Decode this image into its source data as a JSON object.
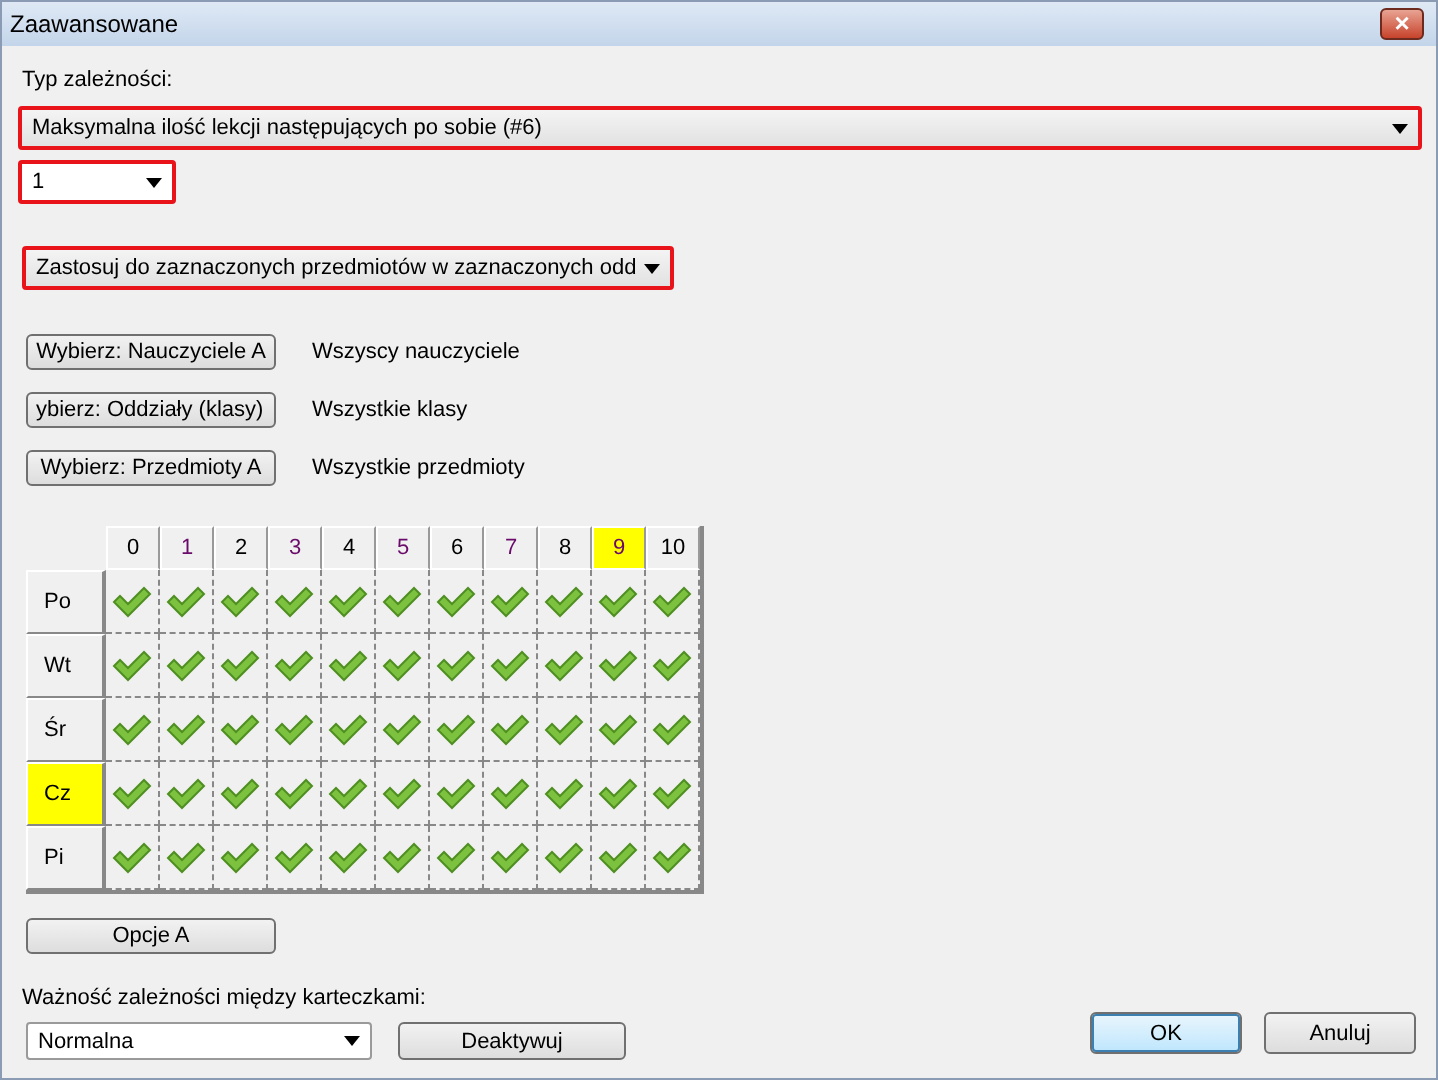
{
  "window": {
    "title": "Zaawansowane",
    "close": "×"
  },
  "dependency_type": {
    "label": "Typ zależności:",
    "value": "Maksymalna ilość lekcji następujących po sobie (#6)",
    "outlined": true
  },
  "count": {
    "value": "1",
    "outlined": true
  },
  "apply_mode": {
    "value": "Zastosuj do zaznaczonych przedmiotów w zaznaczonych odd",
    "outlined": true
  },
  "selectors": [
    {
      "button": "Wybierz: Nauczyciele A",
      "summary": "Wszyscy nauczyciele"
    },
    {
      "button": "ybierz: Oddziały (klasy)",
      "summary": "Wszystkie klasy"
    },
    {
      "button": "Wybierz: Przedmioty A",
      "summary": "Wszystkie przedmioty"
    }
  ],
  "grid": {
    "columns": [
      {
        "label": "0",
        "highlighted": false
      },
      {
        "label": "1",
        "highlighted": false
      },
      {
        "label": "2",
        "highlighted": false
      },
      {
        "label": "3",
        "highlighted": false
      },
      {
        "label": "4",
        "highlighted": false
      },
      {
        "label": "5",
        "highlighted": false
      },
      {
        "label": "6",
        "highlighted": false
      },
      {
        "label": "7",
        "highlighted": false
      },
      {
        "label": "8",
        "highlighted": false
      },
      {
        "label": "9",
        "highlighted": true
      },
      {
        "label": "10",
        "highlighted": false
      }
    ],
    "rows": [
      {
        "label": "Po",
        "highlighted": false,
        "cells": [
          true,
          true,
          true,
          true,
          true,
          true,
          true,
          true,
          true,
          true,
          true
        ]
      },
      {
        "label": "Wt",
        "highlighted": false,
        "cells": [
          true,
          true,
          true,
          true,
          true,
          true,
          true,
          true,
          true,
          true,
          true
        ]
      },
      {
        "label": "Śr",
        "highlighted": false,
        "cells": [
          true,
          true,
          true,
          true,
          true,
          true,
          true,
          true,
          true,
          true,
          true
        ]
      },
      {
        "label": "Cz",
        "highlighted": true,
        "cells": [
          true,
          true,
          true,
          true,
          true,
          true,
          true,
          true,
          true,
          true,
          true
        ]
      },
      {
        "label": "Pi",
        "highlighted": false,
        "cells": [
          true,
          true,
          true,
          true,
          true,
          true,
          true,
          true,
          true,
          true,
          true
        ]
      }
    ]
  },
  "options_button": "Opcje A",
  "importance": {
    "label": "Ważność zależności między karteczkami:",
    "value": "Normalna"
  },
  "deactivate_button": "Deaktywuj",
  "buttons": [
    {
      "label": "OK",
      "default": true
    },
    {
      "label": "Anuluj",
      "default": false
    }
  ]
}
